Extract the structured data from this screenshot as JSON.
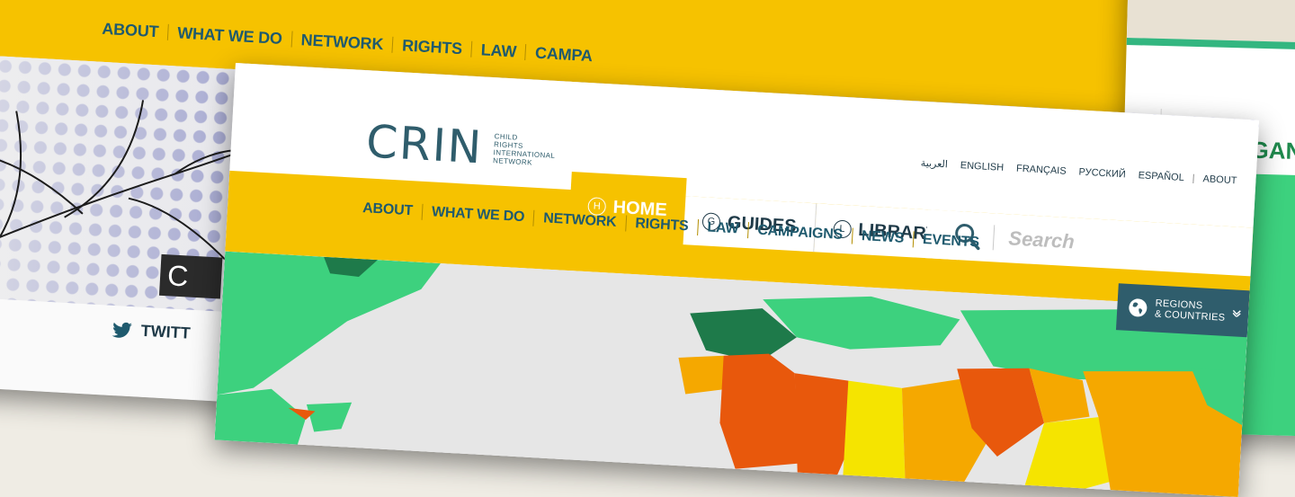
{
  "back_site": {
    "nav": [
      "ABOUT",
      "WHAT WE DO",
      "NETWORK",
      "RIGHTS",
      "LAW",
      "CAMPA"
    ],
    "logo_fragment": "C",
    "twitter_label": "TWITT"
  },
  "right_site": {
    "org_label": "ORGAN"
  },
  "front_site": {
    "logo": {
      "word": "CRIN",
      "subtitle": [
        "CHILD",
        "RIGHTS",
        "INTERNATIONAL",
        "NETWORK"
      ]
    },
    "languages": [
      "العربية",
      "ENGLISH",
      "FRANÇAIS",
      "РУССКИЙ",
      "ESPAÑOL"
    ],
    "about_link": "ABOUT",
    "tabs": [
      {
        "letter": "H",
        "label": "HOME",
        "active": true
      },
      {
        "letter": "G",
        "label": "GUIDES",
        "active": false
      },
      {
        "letter": "L",
        "label": "LIBRARY",
        "active": false
      }
    ],
    "search": {
      "placeholder": "Search"
    },
    "main_nav": [
      "ABOUT",
      "WHAT WE DO",
      "NETWORK",
      "RIGHTS",
      "LAW",
      "CAMPAIGNS",
      "NEWS",
      "EVENTS"
    ],
    "regions_button": [
      "REGIONS",
      "& COUNTRIES"
    ],
    "colors": {
      "yellow": "#f6c200",
      "teal": "#2f5d6c",
      "map_green": "#3dd17e",
      "map_dark_green": "#1e7a4a",
      "map_orange": "#e8580c",
      "map_amber": "#f5a800",
      "map_yellow": "#f5e400"
    }
  }
}
